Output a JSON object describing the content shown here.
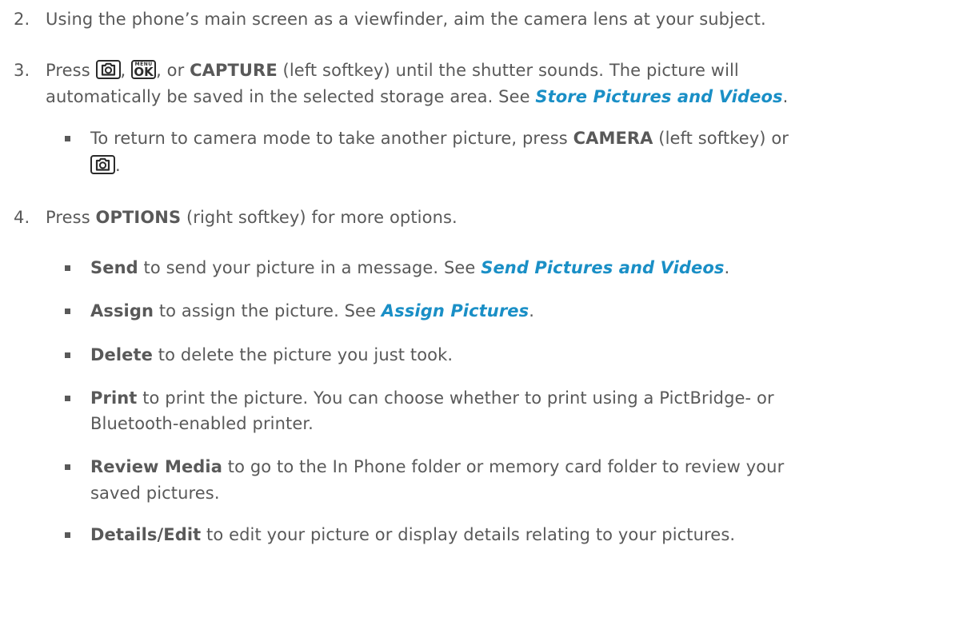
{
  "steps": [
    {
      "number": "2.",
      "text": "Using the phone’s main screen as a viewfinder, aim the camera lens at your subject."
    },
    {
      "number": "3.",
      "t_press": "Press ",
      "t_comma1": ", ",
      "t_comma2": ", or ",
      "capture": "CAPTURE",
      "t_after_capture": " (left softkey) until the shutter sounds. The picture will",
      "line2": "automatically be saved in the selected storage area. See ",
      "link": "Store Pictures and Videos",
      "line2_end": ".",
      "sub": {
        "t1": "To return to camera mode to take another picture, press ",
        "camera": "CAMERA",
        "t2": " (left softkey) or",
        "end": "."
      }
    },
    {
      "number": "4.",
      "t_press": "Press ",
      "options": "OPTIONS",
      "t_rest": " (right softkey) for more options."
    }
  ],
  "keys": {
    "camera_icon": "camera-key-icon",
    "menu_ok_icon": "menu-ok-key-icon",
    "menu_label": "MENU",
    "ok_label": "OK"
  },
  "options": [
    {
      "term": "Send",
      "text": " to send your picture in a message. See ",
      "link": "Send Pictures and Videos",
      "end": "."
    },
    {
      "term": "Assign",
      "text": " to assign the picture. See ",
      "link": "Assign Pictures",
      "end": "."
    },
    {
      "term": "Delete",
      "text": " to delete the picture you just took."
    },
    {
      "term": "Print",
      "text": " to print the picture. You can choose whether to print using a PictBridge- or",
      "line2": "Bluetooth-enabled printer."
    },
    {
      "term": "Review Media",
      "text": " to go to the In Phone folder or memory card folder to review your",
      "line2": "saved pictures."
    },
    {
      "term": "Details/Edit",
      "text": " to edit your picture or display details relating to your pictures."
    }
  ],
  "colors": {
    "body_text": "#595959",
    "link": "#1a8fc6",
    "key_border": "#2b2b2b"
  }
}
